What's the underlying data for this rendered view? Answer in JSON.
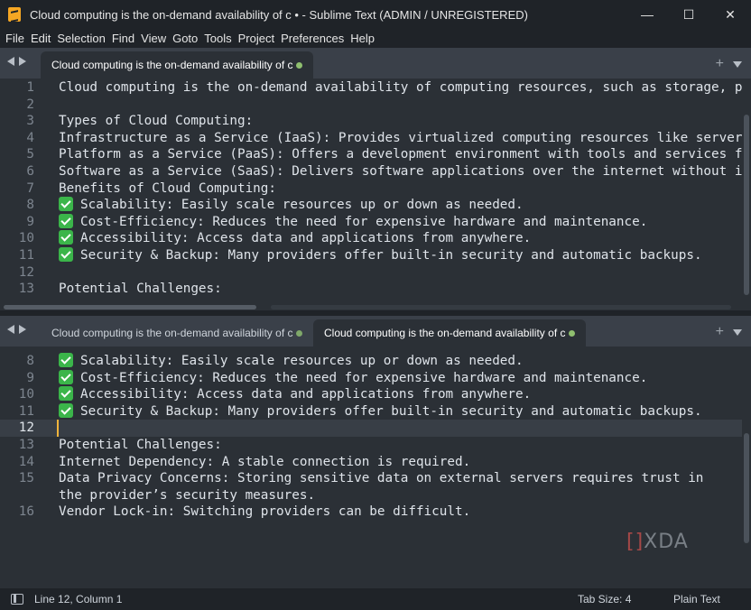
{
  "window": {
    "title": "Cloud computing is the on-demand availability of c • - Sublime Text (ADMIN / UNREGISTERED)",
    "controls": {
      "minimize": "—",
      "maximize": "☐",
      "close": "✕"
    }
  },
  "menu": [
    "File",
    "Edit",
    "Selection",
    "Find",
    "View",
    "Goto",
    "Tools",
    "Project",
    "Preferences",
    "Help"
  ],
  "top_pane": {
    "tab_label": "Cloud computing is the on-demand availability of c",
    "lines": [
      {
        "n": "1",
        "text": "Cloud computing is the on-demand availability of computing resources, such as storage, p"
      },
      {
        "n": "2",
        "text": ""
      },
      {
        "n": "3",
        "text": "Types of Cloud Computing:"
      },
      {
        "n": "4",
        "text": "Infrastructure as a Service (IaaS): Provides virtualized computing resources like server"
      },
      {
        "n": "5",
        "text": "Platform as a Service (PaaS): Offers a development environment with tools and services f"
      },
      {
        "n": "6",
        "text": "Software as a Service (SaaS): Delivers software applications over the internet without i"
      },
      {
        "n": "7",
        "text": "Benefits of Cloud Computing:"
      },
      {
        "n": "8",
        "text": "Scalability: Easily scale resources up or down as needed.",
        "check": true
      },
      {
        "n": "9",
        "text": "Cost-Efficiency: Reduces the need for expensive hardware and maintenance.",
        "check": true
      },
      {
        "n": "10",
        "text": "Accessibility: Access data and applications from anywhere.",
        "check": true
      },
      {
        "n": "11",
        "text": "Security & Backup: Many providers offer built-in security and automatic backups.",
        "check": true
      },
      {
        "n": "12",
        "text": ""
      },
      {
        "n": "13",
        "text": "Potential Challenges:"
      }
    ]
  },
  "bottom_pane": {
    "tabs": [
      {
        "label": "Cloud computing is the on-demand availability of c",
        "active": false
      },
      {
        "label": "Cloud computing is the on-demand availability of c",
        "active": true
      }
    ],
    "lines": [
      {
        "n": "8",
        "text": "Scalability: Easily scale resources up or down as needed.",
        "check": true
      },
      {
        "n": "9",
        "text": "Cost-Efficiency: Reduces the need for expensive hardware and maintenance.",
        "check": true
      },
      {
        "n": "10",
        "text": "Accessibility: Access data and applications from anywhere.",
        "check": true
      },
      {
        "n": "11",
        "text": "Security & Backup: Many providers offer built-in security and automatic backups.",
        "check": true
      },
      {
        "n": "12",
        "text": "",
        "current": true
      },
      {
        "n": "13",
        "text": "Potential Challenges:"
      },
      {
        "n": "14",
        "text": "Internet Dependency: A stable connection is required."
      },
      {
        "n": "15",
        "text": "Data Privacy Concerns: Storing sensitive data on external servers requires trust in"
      },
      {
        "n": "",
        "text": "the provider’s security measures."
      },
      {
        "n": "16",
        "text": "Vendor Lock-in: Switching providers can be difficult."
      }
    ]
  },
  "watermark": {
    "bracket": "[]",
    "text": "XDA"
  },
  "status": {
    "position": "Line 12, Column 1",
    "tab_size": "Tab Size: 4",
    "syntax": "Plain Text"
  },
  "icons": {
    "tab_add": "plus-icon",
    "tab_menu": "chevron-down-icon",
    "nav_left": "arrow-left-icon",
    "nav_right": "arrow-right-icon"
  },
  "colors": {
    "check": "#3bb54a",
    "cursor": "#f0b43c",
    "background": "#2b3036"
  }
}
